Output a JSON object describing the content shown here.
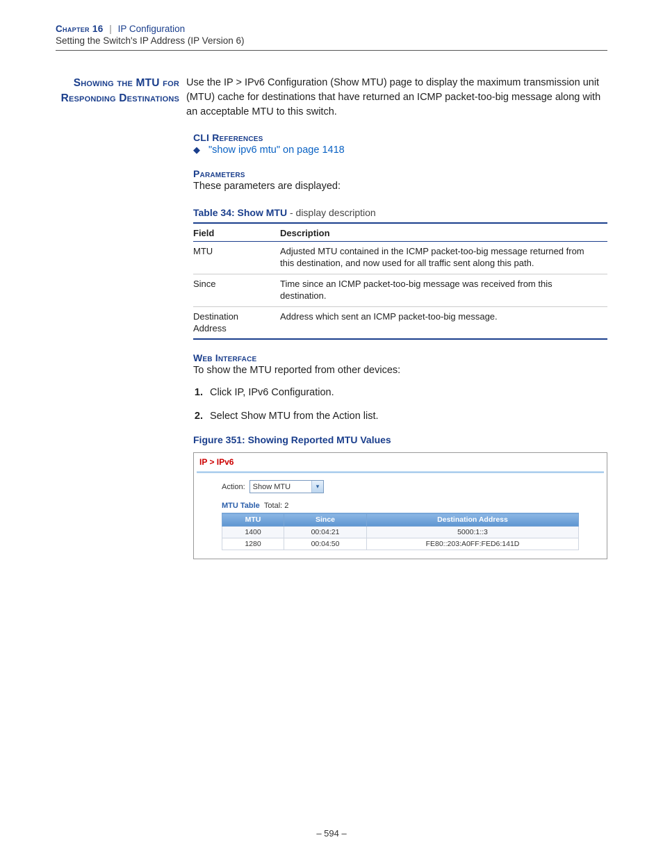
{
  "header": {
    "chapter_label": "Chapter 16",
    "divider": "|",
    "chapter_title": "IP Configuration",
    "subtitle": "Setting the Switch's IP Address (IP Version 6)"
  },
  "section": {
    "side_heading": "Showing the MTU for Responding Destinations",
    "intro": "Use the IP > IPv6 Configuration (Show MTU) page to display the maximum transmission unit (MTU) cache for destinations that have returned an ICMP packet-too-big message along with an acceptable MTU to this switch."
  },
  "cli": {
    "label": "CLI References",
    "bullet": "\"show ipv6 mtu\" on page 1418"
  },
  "params": {
    "label": "Parameters",
    "desc": "These parameters are displayed:"
  },
  "table34": {
    "caption_b": "Table 34: Show MTU",
    "caption_r": " - display description",
    "head_field": "Field",
    "head_desc": "Description",
    "rows": [
      {
        "f": "MTU",
        "d": "Adjusted MTU contained in the ICMP packet-too-big message returned from this destination, and now used for all traffic sent along this path."
      },
      {
        "f": "Since",
        "d": "Time since an ICMP packet-too-big message was received from this destination."
      },
      {
        "f": "Destination Address",
        "d": "Address which sent an ICMP packet-too-big message."
      }
    ]
  },
  "web": {
    "label": "Web Interface",
    "intro": "To show the MTU reported from other devices:",
    "steps": [
      "Click IP, IPv6 Configuration.",
      "Select Show MTU from the Action list."
    ]
  },
  "figure": {
    "caption": "Figure 351:  Showing Reported MTU Values",
    "breadcrumb": "IP > IPv6",
    "action_label": "Action:",
    "action_value": "Show MTU",
    "subtitle_label": "MTU Table",
    "subtitle_count": "Total: 2",
    "cols": [
      "MTU",
      "Since",
      "Destination Address"
    ],
    "rows": [
      {
        "c0": "1400",
        "c1": "00:04:21",
        "c2": "5000:1::3"
      },
      {
        "c0": "1280",
        "c1": "00:04:50",
        "c2": "FE80::203:A0FF:FED6:141D"
      }
    ]
  },
  "footer": {
    "page": "–  594  –"
  }
}
